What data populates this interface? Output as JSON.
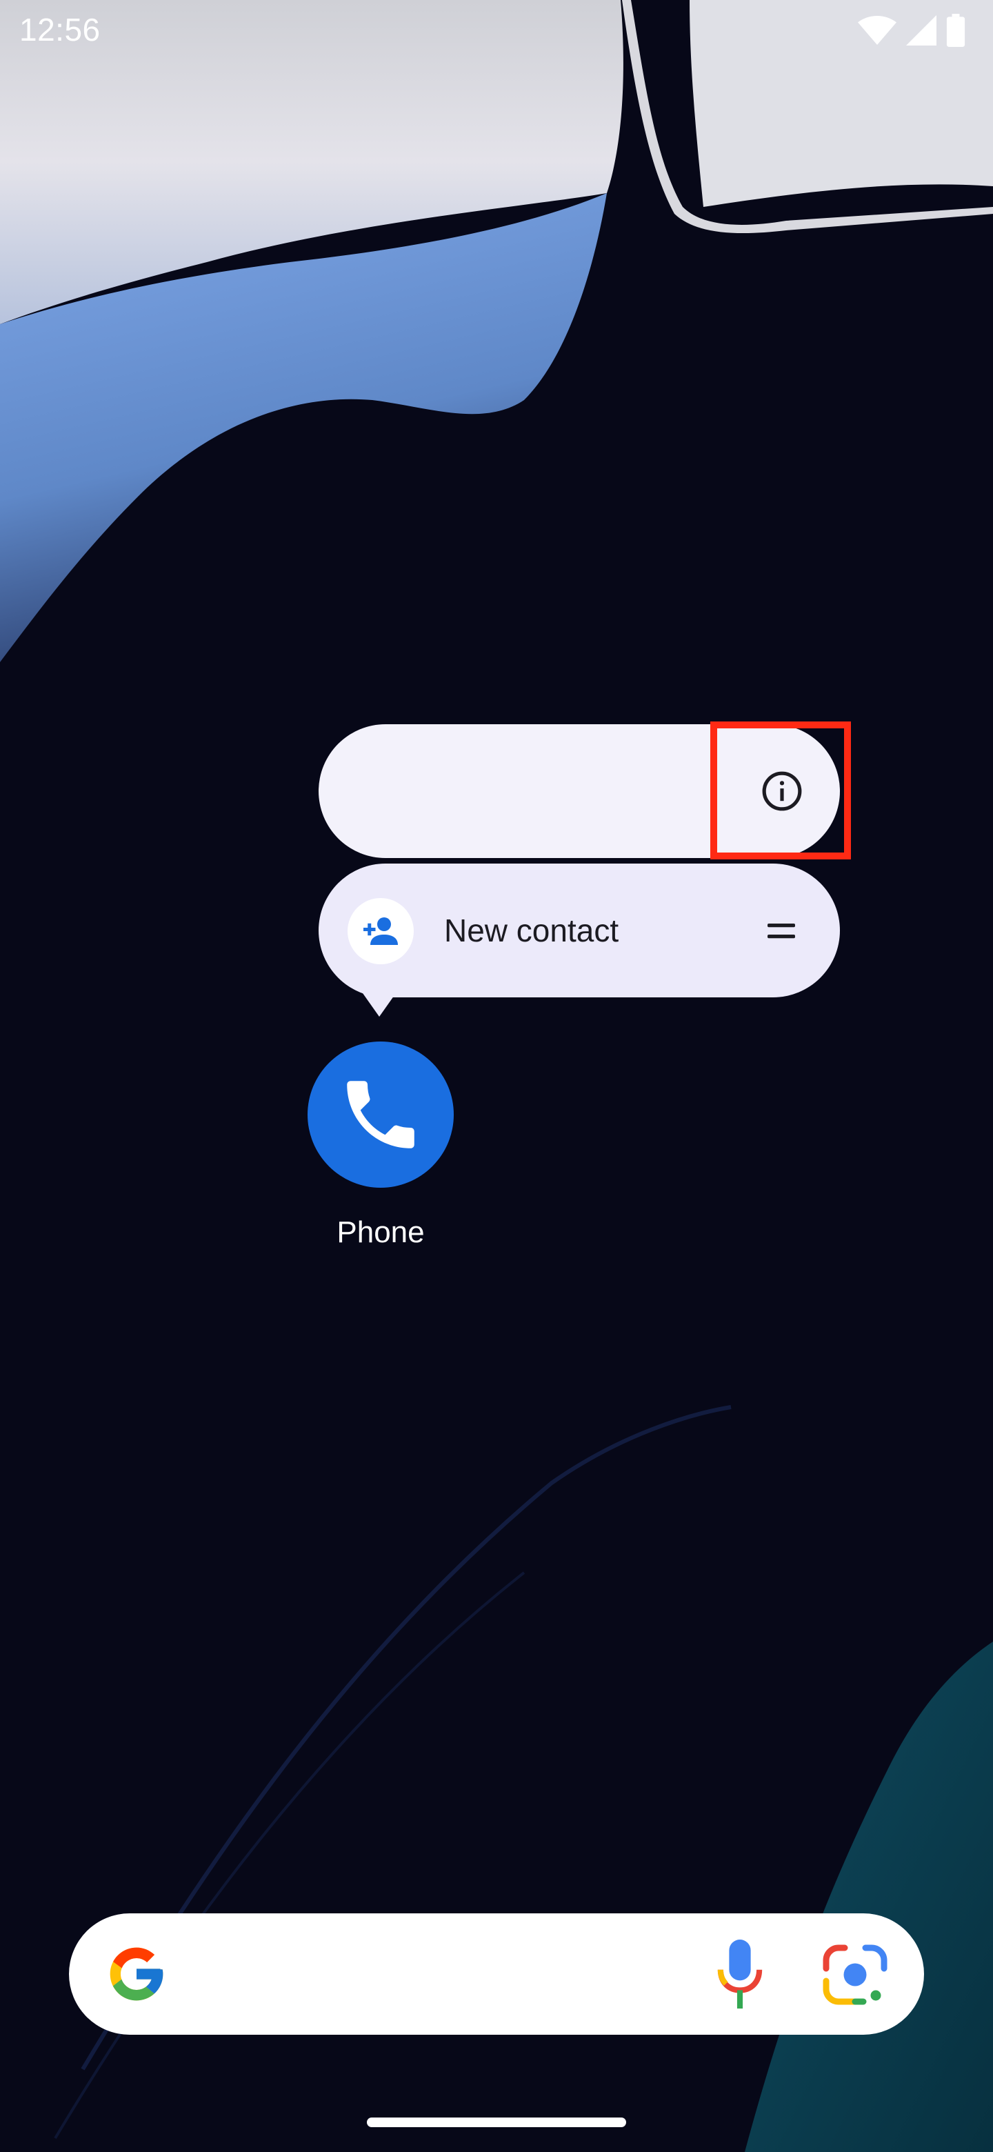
{
  "status_bar": {
    "time": "12:56",
    "icons": [
      "wifi-icon",
      "cell-signal-icon",
      "battery-icon"
    ]
  },
  "popup_menu": {
    "info_button_icon": "info-icon",
    "shortcuts": [
      {
        "label": "New contact",
        "icon": "add-person-icon"
      }
    ],
    "drag_handle_icon": "drag-handle-icon"
  },
  "app": {
    "label": "Phone",
    "icon": "phone-icon",
    "color": "#1a6ee0"
  },
  "search_bar": {
    "icons": [
      "google-logo",
      "mic-icon",
      "lens-icon"
    ]
  },
  "colors": {
    "highlight": "#ff2a14",
    "popup_background": "#f3f2fb"
  }
}
